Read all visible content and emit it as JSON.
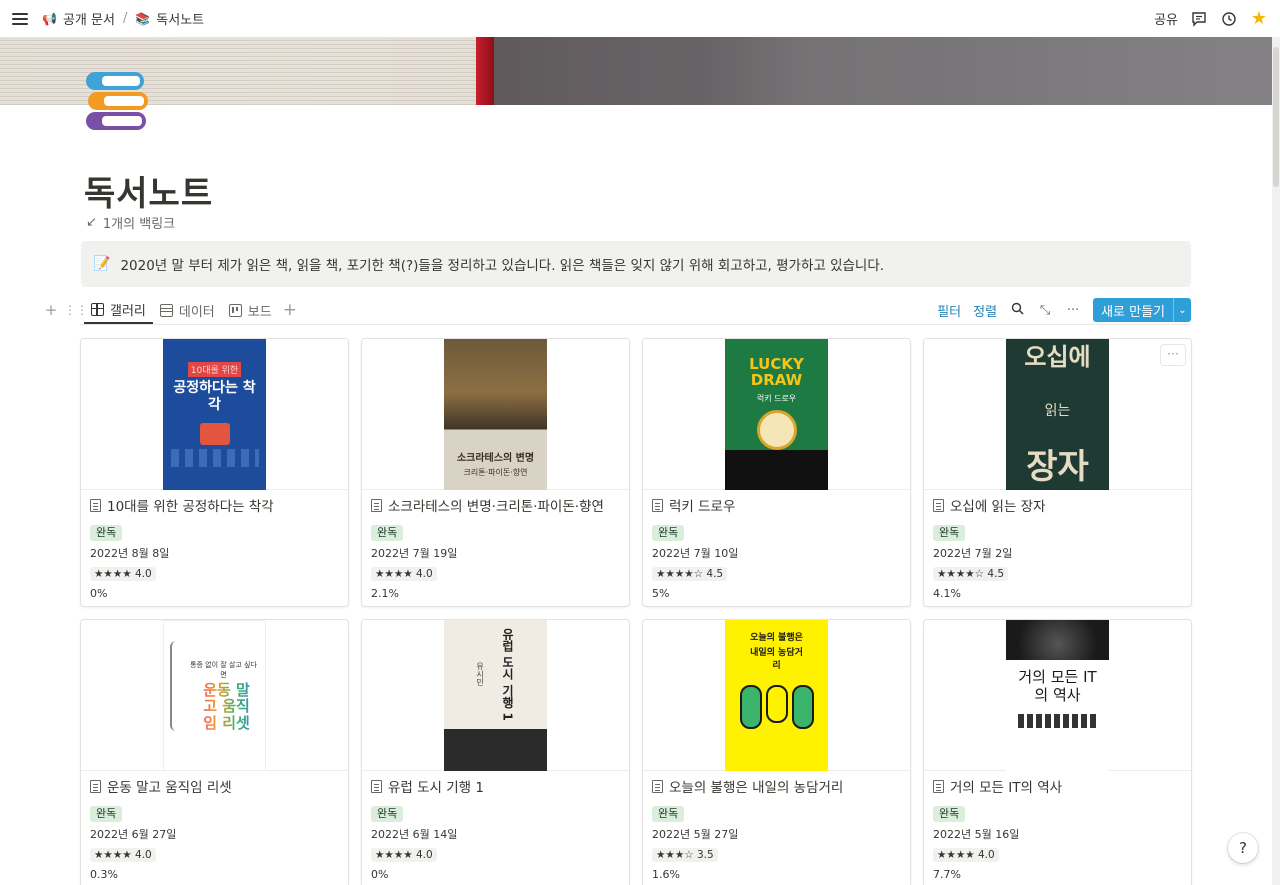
{
  "topbar": {
    "breadcrumb": [
      {
        "emoji": "📢",
        "label": "공개 문서"
      },
      {
        "emoji": "📚",
        "label": "독서노트"
      }
    ],
    "share_label": "공유"
  },
  "page": {
    "title": "독서노트",
    "backlinks": "1개의 백링크",
    "callout_emoji": "📝",
    "callout_text": "2020년 말 부터 제가 읽은 책, 읽을 책, 포기한 책(?)들을 정리하고 있습니다. 읽은 책들은 잊지 않기 위해 회고하고, 평가하고 있습니다."
  },
  "views": {
    "tabs": [
      {
        "label": "갤러리",
        "icon": "gallery-icon",
        "active": true
      },
      {
        "label": "데이터",
        "icon": "table-icon",
        "active": false
      },
      {
        "label": "보드",
        "icon": "board-icon",
        "active": false
      }
    ],
    "filter_label": "필터",
    "sort_label": "정렬",
    "new_label": "새로 만들기"
  },
  "colors": {
    "accent": "#2e9fd8",
    "tag_bg": "#dbeddb",
    "star": "#f5b800"
  },
  "cards": [
    {
      "title": "10대를 위한 공정하다는 착각",
      "status": "완독",
      "date": "2022년 8월 8일",
      "rating": "★★★★ 4.0",
      "progress": "0%",
      "cover": {
        "bg": "#1d4c9c",
        "top": "10대를 위한",
        "main": "공정하다는 착각",
        "fg": "#ffffff"
      }
    },
    {
      "title": "소크라테스의 변명·크리톤·파이돈·향연",
      "status": "완독",
      "date": "2022년 7월 19일",
      "rating": "★★★★ 4.0",
      "progress": "2.1%",
      "cover": {
        "bg": "#6b5a3a",
        "top": "",
        "main": "소크라테스의 변명",
        "sub": "크리톤·파이돈·향연",
        "fg": "#3a2e20"
      }
    },
    {
      "title": "럭키 드로우",
      "status": "완독",
      "date": "2022년 7월 10일",
      "rating": "★★★★☆ 4.5",
      "progress": "5%",
      "cover": {
        "bg": "#1e7a43",
        "top": "",
        "main": "LUCKY DRAW",
        "sub": "럭키 드로우",
        "fg": "#f5c518"
      }
    },
    {
      "title": "오십에 읽는 장자",
      "status": "완독",
      "date": "2022년 7월 2일",
      "rating": "★★★★☆ 4.5",
      "progress": "4.1%",
      "cover": {
        "bg": "#1f3a32",
        "top": "오십에",
        "main": "장자",
        "sub": "읽는",
        "fg": "#e6dcc4"
      }
    },
    {
      "title": "운동 말고 움직임 리셋",
      "status": "완독",
      "date": "2022년 6월 27일",
      "rating": "★★★★ 4.0",
      "progress": "0.3%",
      "cover": {
        "bg": "#ffffff",
        "top": "통증 없이 잘 살고 싶다면",
        "main": "운동 말고 움직임 리셋",
        "fg": "#e84d8a"
      }
    },
    {
      "title": "유럽 도시 기행 1",
      "status": "완독",
      "date": "2022년 6월 14일",
      "rating": "★★★★ 4.0",
      "progress": "0%",
      "cover": {
        "bg": "#f0ebe3",
        "top": "유시민",
        "main": "유럽 도시 기행 1",
        "fg": "#3a3a3a"
      }
    },
    {
      "title": "오늘의 불행은 내일의 농담거리",
      "status": "완독",
      "date": "2022년 5월 27일",
      "rating": "★★★☆ 3.5",
      "progress": "1.6%",
      "cover": {
        "bg": "#fff200",
        "top": "오늘의 불행은",
        "main": "내일의 농담거리",
        "fg": "#1a1a1a"
      }
    },
    {
      "title": "거의 모든 IT의 역사",
      "status": "완독",
      "date": "2022년 5월 16일",
      "rating": "★★★★ 4.0",
      "progress": "7.7%",
      "cover": {
        "bg": "#ffffff",
        "top": "",
        "main": "거의 모든 IT의 역사",
        "fg": "#1a1a1a"
      }
    }
  ]
}
